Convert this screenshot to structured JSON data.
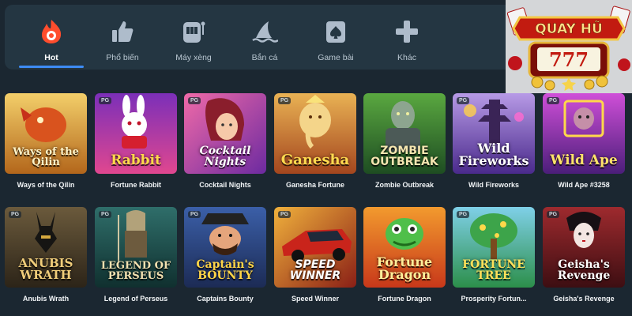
{
  "nav": {
    "items": [
      {
        "label": "Hot",
        "icon": "flame-icon",
        "active": true
      },
      {
        "label": "Phổ biến",
        "icon": "thumbs-up-icon"
      },
      {
        "label": "Máy xèng",
        "icon": "slot-machine-icon"
      },
      {
        "label": "Bắn cá",
        "icon": "shark-fin-icon"
      },
      {
        "label": "Game bài",
        "icon": "playing-card-icon"
      },
      {
        "label": "Khác",
        "icon": "plus-icon"
      }
    ]
  },
  "logo": {
    "text": "QUAY HŨ",
    "digits": "777"
  },
  "colors": {
    "accent": "#3d8cf5",
    "background": "#1b2731",
    "nav_bg": "#243642",
    "flame": "#ff4d2d"
  },
  "games_row1": [
    {
      "name": "Ways of the Qilin",
      "badge": "",
      "art": "Ways of the Qilin"
    },
    {
      "name": "Fortune Rabbit",
      "badge": "PG",
      "art": "Rabbit"
    },
    {
      "name": "Cocktail Nights",
      "badge": "PG",
      "art": "Cocktail Nights"
    },
    {
      "name": "Ganesha Fortune",
      "badge": "PG",
      "art": "Ganesha"
    },
    {
      "name": "Zombie Outbreak",
      "badge": "",
      "art": "ZOMBIE OUTBREAK"
    },
    {
      "name": "Wild Fireworks",
      "badge": "PG",
      "art": "Wild Fireworks"
    },
    {
      "name": "Wild Ape #3258",
      "badge": "PG",
      "art": "Wild Ape"
    }
  ],
  "games_row2": [
    {
      "name": "Anubis Wrath",
      "badge": "PG",
      "art": "ANUBIS WRATH"
    },
    {
      "name": "Legend of Perseus",
      "badge": "PG",
      "art": "LEGEND OF PERSEUS"
    },
    {
      "name": "Captains Bounty",
      "badge": "PG",
      "art": "Captain's BOUNTY"
    },
    {
      "name": "Speed Winner",
      "badge": "PG",
      "art": "SPEED WINNER"
    },
    {
      "name": "Fortune Dragon",
      "badge": "",
      "art": "Fortune Dragon"
    },
    {
      "name": "Prosperity Fortun...",
      "badge": "PG",
      "art": "FORTUNE TREE"
    },
    {
      "name": "Geisha's Revenge",
      "badge": "PG",
      "art": "Geisha's Revenge"
    }
  ]
}
